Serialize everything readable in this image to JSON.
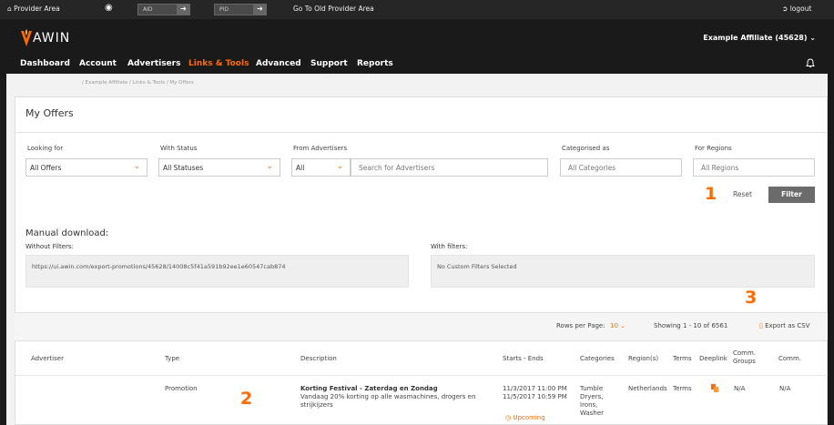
{
  "provider_bar": {
    "provider_area": "Provider Area",
    "aid_placeholder": "AID",
    "pid_placeholder": "PID",
    "old_provider_link": "Go To Old Provider Area",
    "logout": "logout"
  },
  "brand": {
    "logo": "AWIN",
    "affiliate": "Example Affiliate (45628)"
  },
  "nav": {
    "items": [
      "Dashboard",
      "Account",
      "Advertisers",
      "Links & Tools",
      "Advanced",
      "Support",
      "Reports"
    ],
    "active_index": 3
  },
  "breadcrumb": "/ Example Affiliate / Links & Tools / My Offers",
  "page_title": "My Offers",
  "filters": {
    "looking_for": {
      "label": "Looking for",
      "value": "All Offers"
    },
    "with_status": {
      "label": "With Status",
      "value": "All Statuses"
    },
    "from_advertisers": {
      "label": "From Advertisers",
      "value": "All",
      "search_placeholder": "Search for Advertisers"
    },
    "categorised_as": {
      "label": "Categorised as",
      "placeholder": "All Categories"
    },
    "for_regions": {
      "label": "For Regions",
      "placeholder": "All Regions"
    },
    "reset": "Reset",
    "filter": "Filter"
  },
  "annotations": {
    "one": "1",
    "two": "2",
    "three": "3"
  },
  "manual_download": {
    "title": "Manual download:",
    "without_label": "Without Filters:",
    "without_value": "https://ui.awin.com/export-promotions/45628/14008c5f41a591b92ee1e60547cab874",
    "with_label": "With filters:",
    "with_value": "No Custom Filters Selected"
  },
  "pagination": {
    "rows_label": "Rows per Page:",
    "rows_value": "10",
    "showing": "Showing 1 - 10 of 6561",
    "export": "Export as CSV"
  },
  "table": {
    "headers": [
      "Advertiser",
      "Type",
      "Description",
      "Starts - Ends",
      "Categories",
      "Region(s)",
      "Terms",
      "Deeplink",
      "Comm. Groups",
      "Comm."
    ],
    "rows": [
      {
        "advertiser": "",
        "type": "Promotion",
        "title": "Korting Festival - Zaterdag en Zondag",
        "desc": "Vandaag 20% korting op alle wasmachines, drogers en strijkijzers",
        "starts": "11/3/2017 11:00 PM",
        "ends": "11/5/2017 10:59 PM",
        "status": "Upcoming",
        "categories": "Tumble Dryers, Irons, Washer",
        "regions": "Netherlands",
        "terms": "Terms",
        "comm_groups": "N/A",
        "comm": "N/A"
      }
    ]
  },
  "colors": {
    "accent": "#ff6b00",
    "dark": "#1a1a1a",
    "button": "#6b6b6b"
  }
}
